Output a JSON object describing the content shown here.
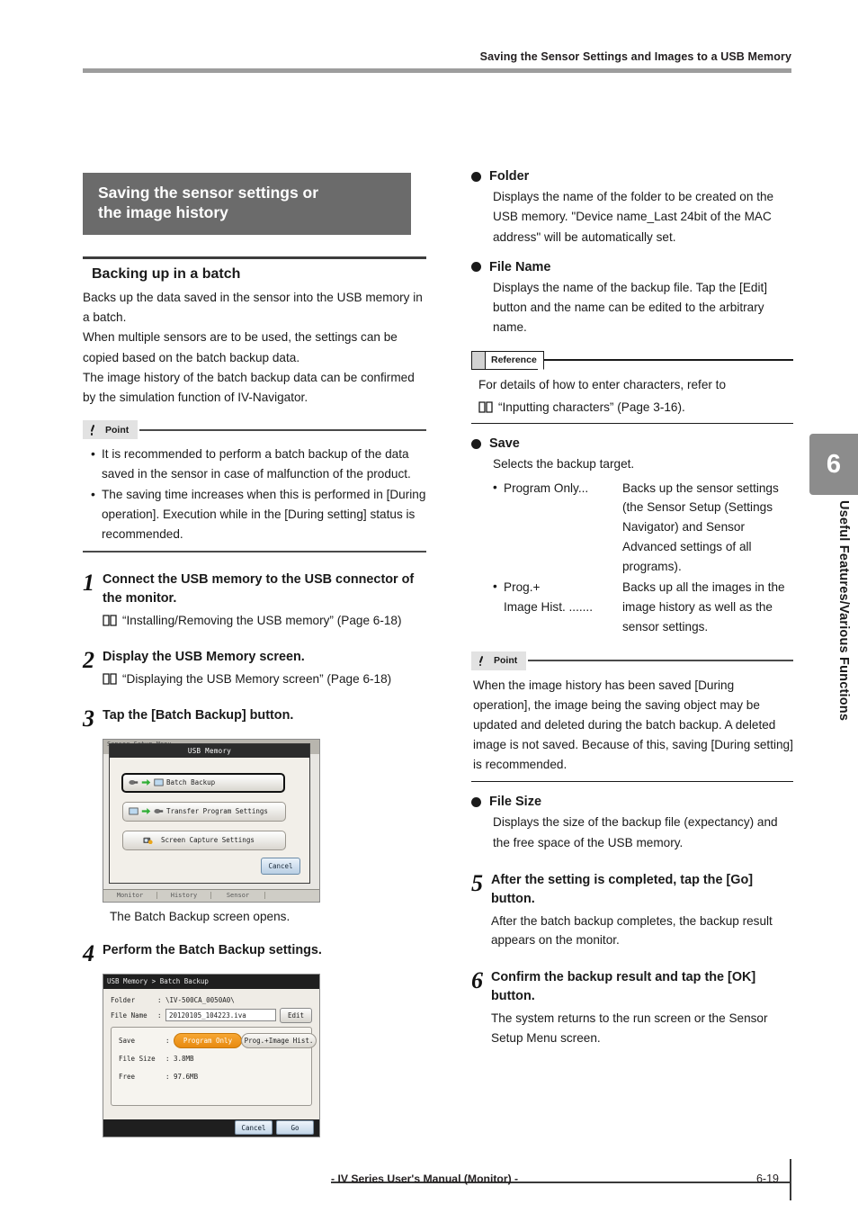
{
  "header": {
    "running_title": "Saving the Sensor Settings and Images to a USB Memory"
  },
  "footer": {
    "manual_title": "- IV Series User's Manual (Monitor) -",
    "page_number": "6-19"
  },
  "side_tab": {
    "chapter_number": "6",
    "chapter_title": "Useful Features/Various Functions"
  },
  "left": {
    "section_title_line1": "Saving the sensor settings or",
    "section_title_line2": "the image history",
    "subsection_title": "Backing up in a batch",
    "intro": "Backs up the data saved in the sensor into the USB memory in a batch.\nWhen multiple sensors are to be used, the settings can be copied based on the batch backup data.\nThe image history of the batch backup data can be confirmed by the simulation function of IV-Navigator.",
    "point": {
      "label": "Point",
      "items": [
        "It is recommended to perform a batch backup of the data saved in the sensor in case of malfunction of the product.",
        "The saving time increases when this is performed in [During operation]. Execution while in the [During setting] status is recommended."
      ]
    },
    "steps": [
      {
        "num": "1",
        "title": "Connect the USB memory to the USB connector of the monitor.",
        "book_ref": "“Installing/Removing the USB memory” (Page 6-18)"
      },
      {
        "num": "2",
        "title": "Display the USB Memory screen.",
        "book_ref": "“Displaying the USB Memory screen” (Page 6-18)"
      },
      {
        "num": "3",
        "title": "Tap the [Batch Backup] button.",
        "caption": "The Batch Backup screen opens."
      },
      {
        "num": "4",
        "title": "Perform the Batch Backup settings."
      }
    ],
    "screenshot_usb_memory": {
      "background_title": "Sensor Setup Menu",
      "dialog_title": "USB Memory",
      "buttons": [
        "Batch Backup",
        "Transfer Program Settings",
        "Screen Capture Settings"
      ],
      "cancel_label": "Cancel",
      "tabs": [
        "Monitor",
        "History",
        "Sensor",
        ""
      ]
    },
    "screenshot_batch_backup": {
      "title": "USB Memory > Batch Backup",
      "folder_label": "Folder",
      "folder_value": "\\IV-500CA_0050A0\\",
      "file_name_label": "File Name",
      "file_name_value": "20120105_104223.iva",
      "edit_label": "Edit",
      "save_label": "Save",
      "save_option_selected": "Program Only",
      "save_option_other": "Prog.+Image Hist.",
      "file_size_label": "File Size",
      "file_size_value": "3.8MB",
      "free_label": "Free",
      "free_value": "97.6MB",
      "cancel_label": "Cancel",
      "go_label": "Go"
    }
  },
  "right": {
    "items": [
      {
        "title": "Folder",
        "body": "Displays the name of the folder to be created on the USB memory. \"Device name_Last 24bit of the MAC address\" will be automatically set."
      },
      {
        "title": "File Name",
        "body": "Displays the name of the backup file. Tap the [Edit] button and the name can be edited to the arbitrary name."
      }
    ],
    "reference": {
      "label": "Reference",
      "line1": "For details of how to enter characters, refer to",
      "book_ref": "“Inputting characters” (Page 3-16)."
    },
    "save": {
      "title": "Save",
      "intro": "Selects the backup target.",
      "rows": [
        {
          "term": "Program Only",
          "dots": "...",
          "desc": "Backs up the sensor settings (the Sensor Setup (Settings Navigator) and Sensor Advanced settings of all programs)."
        },
        {
          "term": "Prog.+\nImage Hist.",
          "dots": ".......",
          "desc": "Backs up all the images in the image history as well as the sensor settings."
        }
      ]
    },
    "point": {
      "label": "Point",
      "body": "When the image history has been saved [During operation], the image being the saving object may be updated and deleted during the batch backup. A deleted image is not saved. Because of this, saving [During setting] is recommended."
    },
    "file_size": {
      "title": "File Size",
      "body": "Displays the size of the backup file (expectancy) and the free space of the USB memory."
    },
    "steps": [
      {
        "num": "5",
        "title": "After the setting is completed, tap the [Go] button.",
        "body": "After the batch backup completes, the backup result appears on the monitor."
      },
      {
        "num": "6",
        "title": "Confirm the backup result and tap the [OK] button.",
        "body": "The system returns to the run screen or the Sensor Setup Menu screen."
      }
    ]
  }
}
